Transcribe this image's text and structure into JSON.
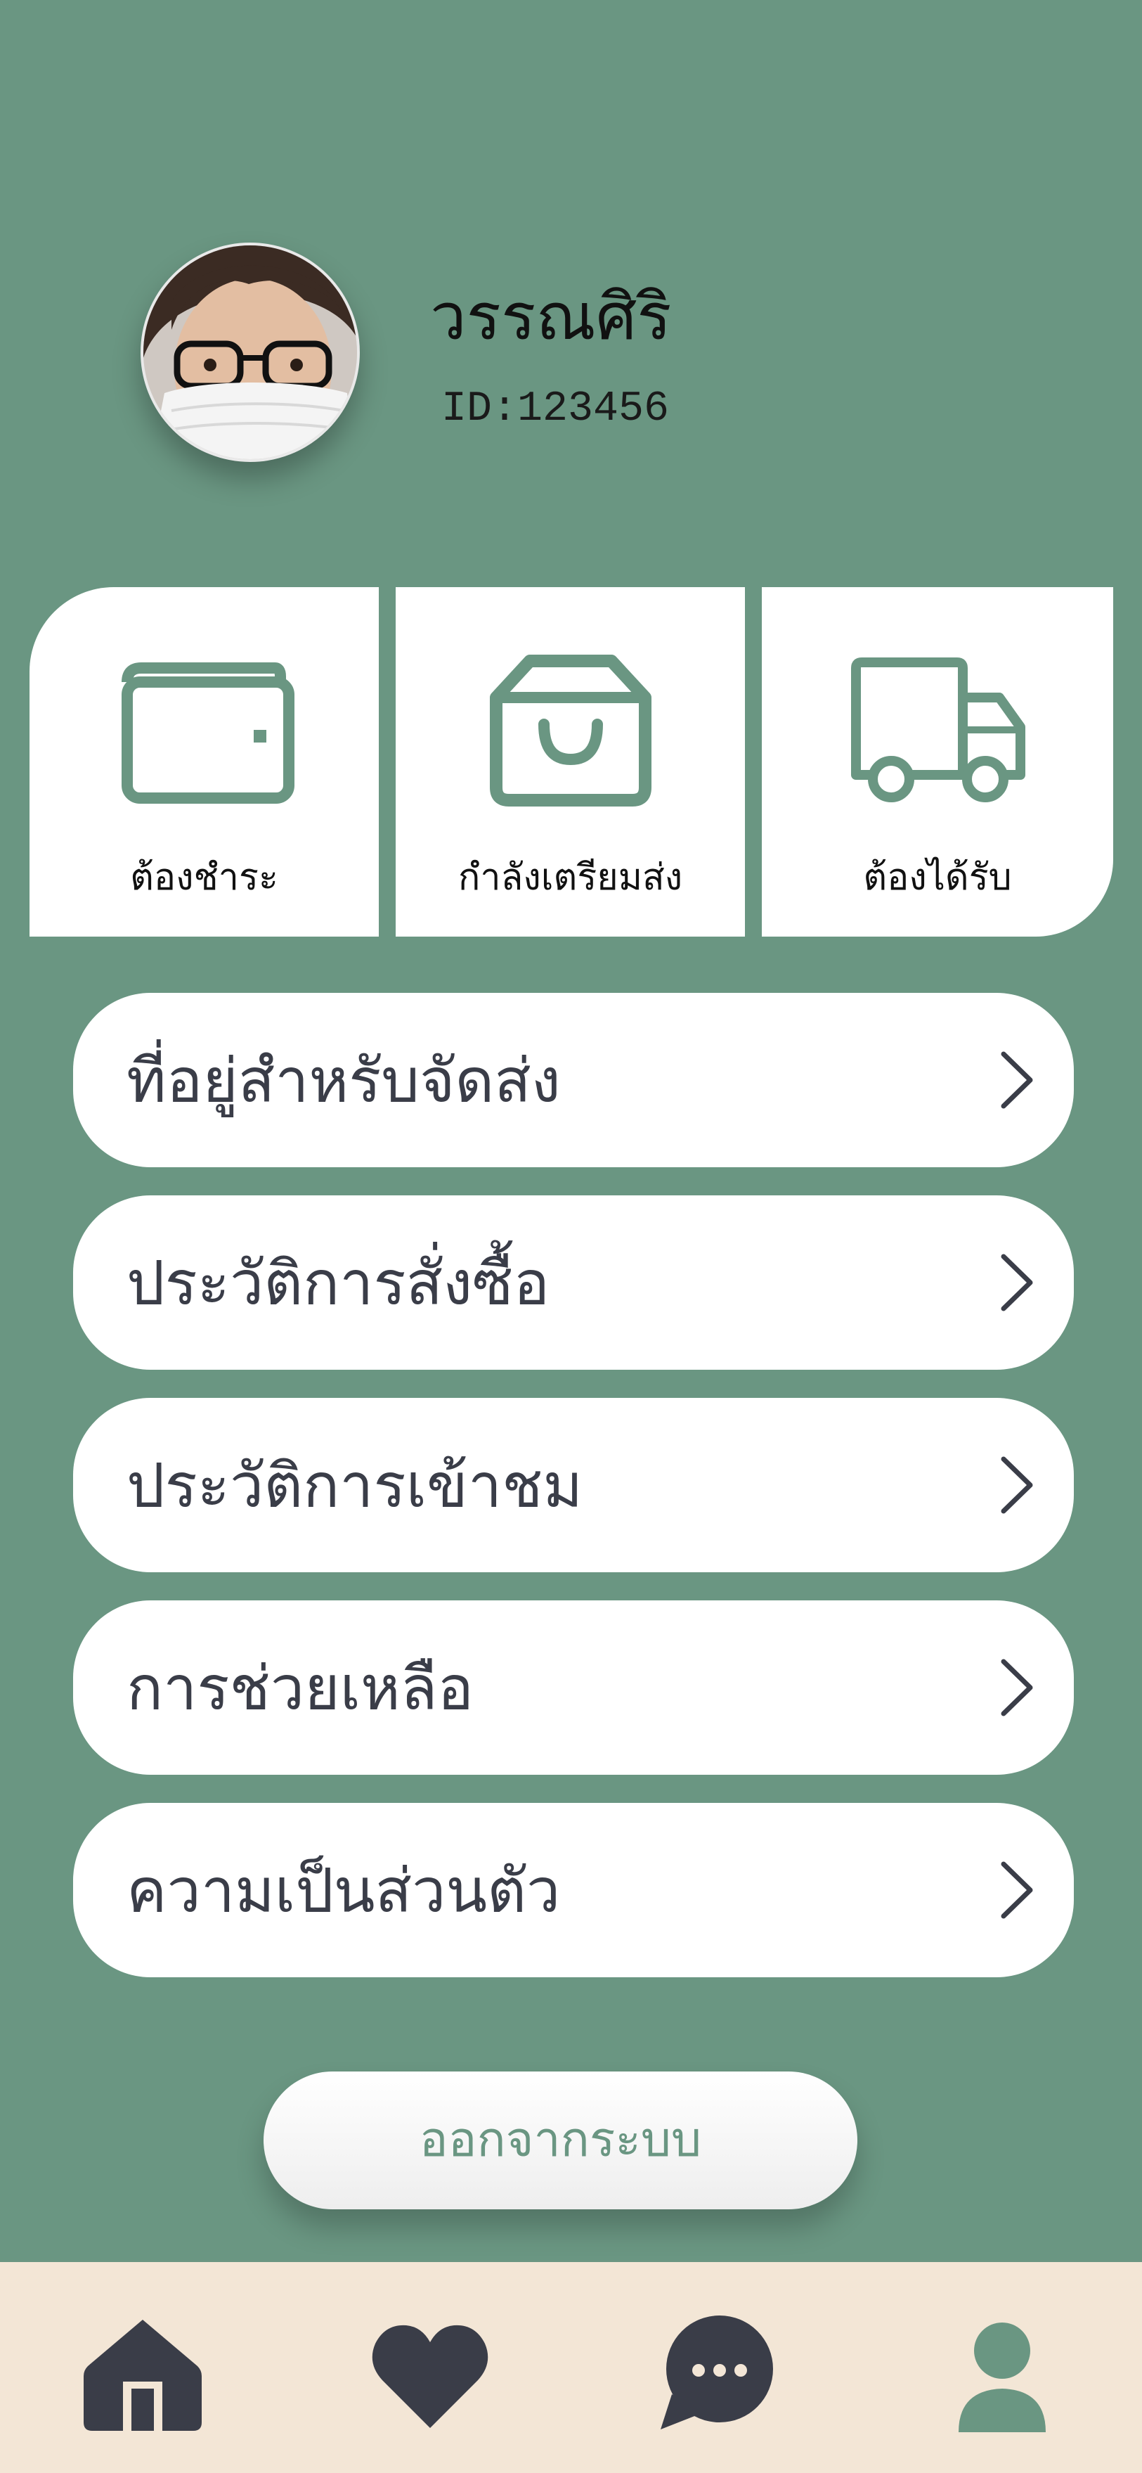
{
  "profile": {
    "name": "วรรณศิริ",
    "user_id": "ID:123456",
    "avatar_alt": "avatar"
  },
  "order_status": [
    {
      "label": "ต้องชำระ",
      "icon": "wallet-icon"
    },
    {
      "label": "กำลังเตรียมส่ง",
      "icon": "shopping-bag-icon"
    },
    {
      "label": "ต้องได้รับ",
      "icon": "delivery-truck-icon"
    }
  ],
  "menu": [
    {
      "label": "ที่อยู่สำหรับจัดส่ง"
    },
    {
      "label": "ประวัติการสั่งซื้อ"
    },
    {
      "label": "ประวัติการเข้าชม"
    },
    {
      "label": "การช่วยเหลือ"
    },
    {
      "label": "ความเป็นส่วนตัว"
    }
  ],
  "logout": {
    "label": "ออกจากระบบ"
  },
  "bottom_nav": [
    {
      "name": "home",
      "icon": "home-icon"
    },
    {
      "name": "favorites",
      "icon": "heart-icon"
    },
    {
      "name": "chat",
      "icon": "chat-bubble-icon"
    },
    {
      "name": "profile",
      "icon": "user-icon",
      "active": true
    }
  ],
  "colors": {
    "background": "#6a9682",
    "card": "#ffffff",
    "text_dark": "#3a3d48",
    "nav_background": "#f3e6d6",
    "nav_icon": "#3a3d48",
    "nav_active": "#6a9682"
  }
}
